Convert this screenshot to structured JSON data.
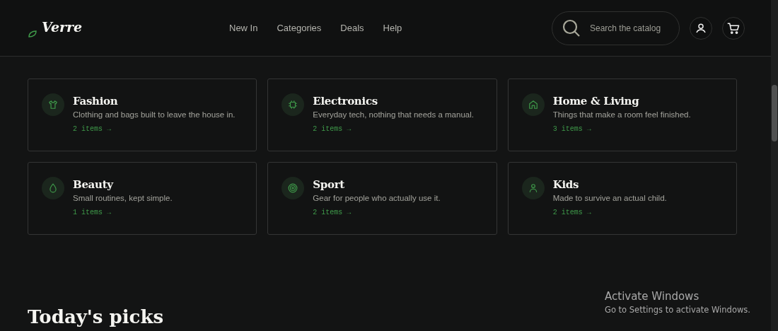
{
  "header": {
    "logo": "Verre",
    "nav": [
      {
        "label": "New In"
      },
      {
        "label": "Categories"
      },
      {
        "label": "Deals"
      },
      {
        "label": "Help"
      }
    ],
    "search": {
      "placeholder": "Search the catalog"
    }
  },
  "categories": [
    {
      "kind": "shirt",
      "title": "Fashion",
      "description": "Clothing and bags built to leave the house in.",
      "count": "2 items →"
    },
    {
      "kind": "chip",
      "title": "Electronics",
      "description": "Everyday tech, nothing that needs a manual.",
      "count": "2 items →"
    },
    {
      "kind": "house",
      "title": "Home & Living",
      "description": "Things that make a room feel finished.",
      "count": "3 items →"
    },
    {
      "kind": "drop",
      "title": "Beauty",
      "description": "Small routines, kept simple.",
      "count": "1 items →"
    },
    {
      "kind": "target",
      "title": "Sport",
      "description": "Gear for people who actually use it.",
      "count": "2 items →"
    },
    {
      "kind": "person",
      "title": "Kids",
      "description": "Made to survive an actual child.",
      "count": "2 items →"
    }
  ],
  "picks": {
    "heading": "Today's picks"
  },
  "os_notice": {
    "title": "Activate Windows",
    "message": "Go to Settings to activate Windows."
  }
}
